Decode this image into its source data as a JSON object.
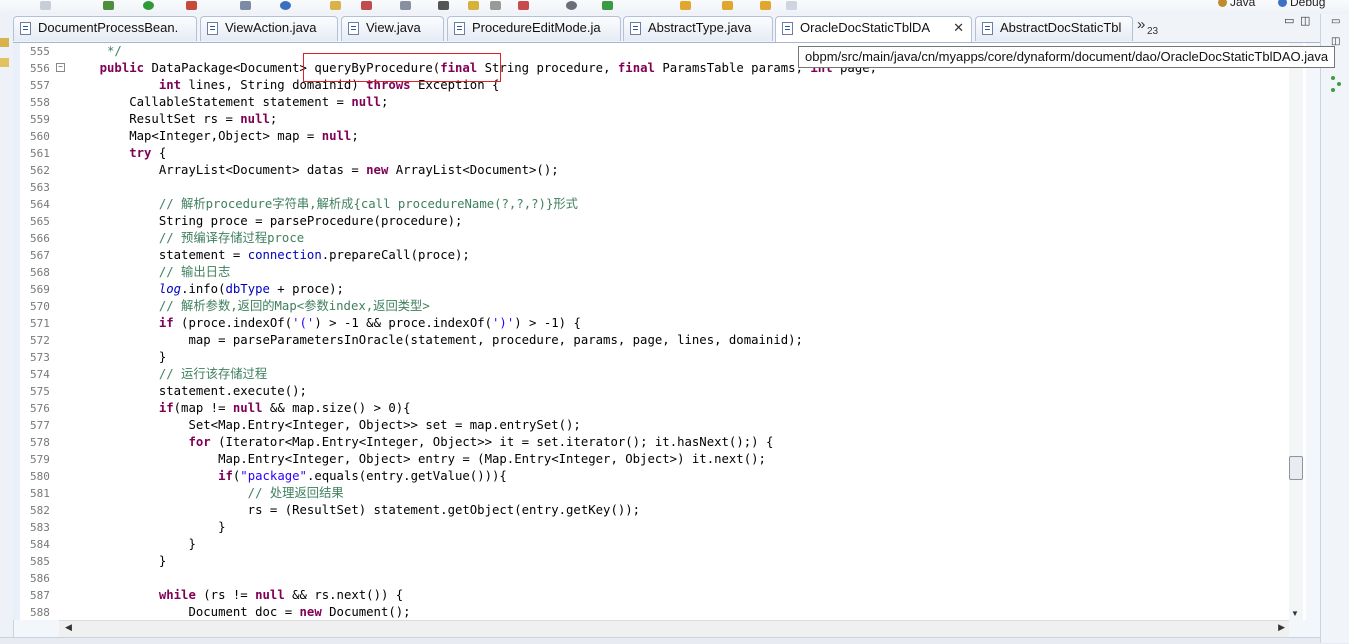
{
  "toolbar": {
    "perspectives": [
      {
        "label": "Java",
        "color": "#c08a2e"
      },
      {
        "label": "Debug",
        "color": "#3a73c4"
      }
    ]
  },
  "tabs": [
    {
      "label": "DocumentProcessBean."
    },
    {
      "label": "ViewAction.java"
    },
    {
      "label": "View.java"
    },
    {
      "label": "ProcedureEditMode.ja"
    },
    {
      "label": "AbstractType.java"
    },
    {
      "label": "OracleDocStaticTblDA"
    },
    {
      "label": "AbstractDocStaticTbl"
    }
  ],
  "tabs_overflow": {
    "glyph": "»",
    "count": "23"
  },
  "tab_close_glyph": "✕",
  "window_controls": {
    "minimize": "▭",
    "maximize": "◫"
  },
  "tooltip": "obpm/src/main/java/cn/myapps/core/dynaform/document/dao/OracleDocStaticTblDAO.java",
  "editor": {
    "fold_glyph": "−",
    "lines": [
      {
        "n": "555",
        "tokens": [
          {
            "t": "     */",
            "c": "cm"
          }
        ]
      },
      {
        "n": "556",
        "tokens": [
          {
            "t": "    ",
            "c": ""
          },
          {
            "t": "public",
            "c": "kw"
          },
          {
            "t": " DataPackage<Document> queryByProcedure(",
            "c": ""
          },
          {
            "t": "final",
            "c": "kw"
          },
          {
            "t": " String procedure, ",
            "c": ""
          },
          {
            "t": "final",
            "c": "kw"
          },
          {
            "t": " ParamsTable params, ",
            "c": ""
          },
          {
            "t": "int",
            "c": "kw"
          },
          {
            "t": " page,",
            "c": ""
          }
        ]
      },
      {
        "n": "557",
        "tokens": [
          {
            "t": "            ",
            "c": ""
          },
          {
            "t": "int",
            "c": "kw"
          },
          {
            "t": " lines, String domainid) ",
            "c": ""
          },
          {
            "t": "throws",
            "c": "kw"
          },
          {
            "t": " Exception {",
            "c": ""
          }
        ]
      },
      {
        "n": "558",
        "tokens": [
          {
            "t": "        CallableStatement statement = ",
            "c": ""
          },
          {
            "t": "null",
            "c": "kw"
          },
          {
            "t": ";",
            "c": ""
          }
        ]
      },
      {
        "n": "559",
        "tokens": [
          {
            "t": "        ResultSet rs = ",
            "c": ""
          },
          {
            "t": "null",
            "c": "kw"
          },
          {
            "t": ";",
            "c": ""
          }
        ]
      },
      {
        "n": "560",
        "tokens": [
          {
            "t": "        Map<Integer,Object> map = ",
            "c": ""
          },
          {
            "t": "null",
            "c": "kw"
          },
          {
            "t": ";",
            "c": ""
          }
        ]
      },
      {
        "n": "561",
        "tokens": [
          {
            "t": "        ",
            "c": ""
          },
          {
            "t": "try",
            "c": "kw"
          },
          {
            "t": " {",
            "c": ""
          }
        ]
      },
      {
        "n": "562",
        "tokens": [
          {
            "t": "            ArrayList<Document> datas = ",
            "c": ""
          },
          {
            "t": "new",
            "c": "kw"
          },
          {
            "t": " ArrayList<Document>();",
            "c": ""
          }
        ]
      },
      {
        "n": "563",
        "tokens": []
      },
      {
        "n": "564",
        "tokens": [
          {
            "t": "            // 解析procedure字符串,解析成{call procedureName(?,?,?)}形式",
            "c": "cm"
          }
        ]
      },
      {
        "n": "565",
        "tokens": [
          {
            "t": "            String proce = parseProcedure(procedure);",
            "c": ""
          }
        ]
      },
      {
        "n": "566",
        "tokens": [
          {
            "t": "            // 预编译存储过程proce",
            "c": "cm"
          }
        ]
      },
      {
        "n": "567",
        "tokens": [
          {
            "t": "            statement = ",
            "c": ""
          },
          {
            "t": "connection",
            "c": "fd"
          },
          {
            "t": ".prepareCall(proce);",
            "c": ""
          }
        ]
      },
      {
        "n": "568",
        "tokens": [
          {
            "t": "            // 输出日志",
            "c": "cm"
          }
        ]
      },
      {
        "n": "569",
        "tokens": [
          {
            "t": "            ",
            "c": ""
          },
          {
            "t": "log",
            "c": "fi"
          },
          {
            "t": ".info(",
            "c": ""
          },
          {
            "t": "dbType",
            "c": "fd"
          },
          {
            "t": " + proce);",
            "c": ""
          }
        ]
      },
      {
        "n": "570",
        "tokens": [
          {
            "t": "            // 解析参数,返回的Map<参数index,返回类型>",
            "c": "cm"
          }
        ]
      },
      {
        "n": "571",
        "tokens": [
          {
            "t": "            ",
            "c": ""
          },
          {
            "t": "if",
            "c": "kw"
          },
          {
            "t": " (proce.indexOf(",
            "c": ""
          },
          {
            "t": "'('",
            "c": "st"
          },
          {
            "t": ") > -1 && proce.indexOf(",
            "c": ""
          },
          {
            "t": "')'",
            "c": "st"
          },
          {
            "t": ") > -1) {",
            "c": ""
          }
        ]
      },
      {
        "n": "572",
        "tokens": [
          {
            "t": "                map = parseParametersInOracle(statement, procedure, params, page, lines, domainid);",
            "c": ""
          }
        ]
      },
      {
        "n": "573",
        "tokens": [
          {
            "t": "            }",
            "c": ""
          }
        ]
      },
      {
        "n": "574",
        "tokens": [
          {
            "t": "            // 运行该存储过程",
            "c": "cm"
          }
        ]
      },
      {
        "n": "575",
        "tokens": [
          {
            "t": "            statement.execute();",
            "c": ""
          }
        ]
      },
      {
        "n": "576",
        "tokens": [
          {
            "t": "            ",
            "c": ""
          },
          {
            "t": "if",
            "c": "kw"
          },
          {
            "t": "(map != ",
            "c": ""
          },
          {
            "t": "null",
            "c": "kw"
          },
          {
            "t": " && map.size() > 0){",
            "c": ""
          }
        ]
      },
      {
        "n": "577",
        "tokens": [
          {
            "t": "                Set<Map.Entry<Integer, Object>> set = map.entrySet();",
            "c": ""
          }
        ]
      },
      {
        "n": "578",
        "tokens": [
          {
            "t": "                ",
            "c": ""
          },
          {
            "t": "for",
            "c": "kw"
          },
          {
            "t": " (Iterator<Map.Entry<Integer, Object>> it = set.iterator(); it.hasNext();) {",
            "c": ""
          }
        ]
      },
      {
        "n": "579",
        "tokens": [
          {
            "t": "                    Map.Entry<Integer, Object> entry = (Map.Entry<Integer, Object>) it.next();",
            "c": ""
          }
        ]
      },
      {
        "n": "580",
        "tokens": [
          {
            "t": "                    ",
            "c": ""
          },
          {
            "t": "if",
            "c": "kw"
          },
          {
            "t": "(",
            "c": ""
          },
          {
            "t": "\"package\"",
            "c": "st"
          },
          {
            "t": ".equals(entry.getValue())){",
            "c": ""
          }
        ]
      },
      {
        "n": "581",
        "tokens": [
          {
            "t": "                        // 处理返回结果",
            "c": "cm"
          }
        ]
      },
      {
        "n": "582",
        "tokens": [
          {
            "t": "                        rs = (ResultSet) statement.getObject(entry.getKey());",
            "c": ""
          }
        ]
      },
      {
        "n": "583",
        "tokens": [
          {
            "t": "                    }",
            "c": ""
          }
        ]
      },
      {
        "n": "584",
        "tokens": [
          {
            "t": "                }",
            "c": ""
          }
        ]
      },
      {
        "n": "585",
        "tokens": [
          {
            "t": "            }",
            "c": ""
          }
        ]
      },
      {
        "n": "586",
        "tokens": []
      },
      {
        "n": "587",
        "tokens": [
          {
            "t": "            ",
            "c": ""
          },
          {
            "t": "while",
            "c": "kw"
          },
          {
            "t": " (rs != ",
            "c": ""
          },
          {
            "t": "null",
            "c": "kw"
          },
          {
            "t": " && rs.next()) {",
            "c": ""
          }
        ]
      },
      {
        "n": "588",
        "tokens": [
          {
            "t": "                Document doc = ",
            "c": ""
          },
          {
            "t": "new",
            "c": "kw"
          },
          {
            "t": " Document();",
            "c": ""
          }
        ]
      }
    ]
  },
  "scrollbars": {
    "up": "▲",
    "down": "▼",
    "left": "◀",
    "right": "▶"
  }
}
